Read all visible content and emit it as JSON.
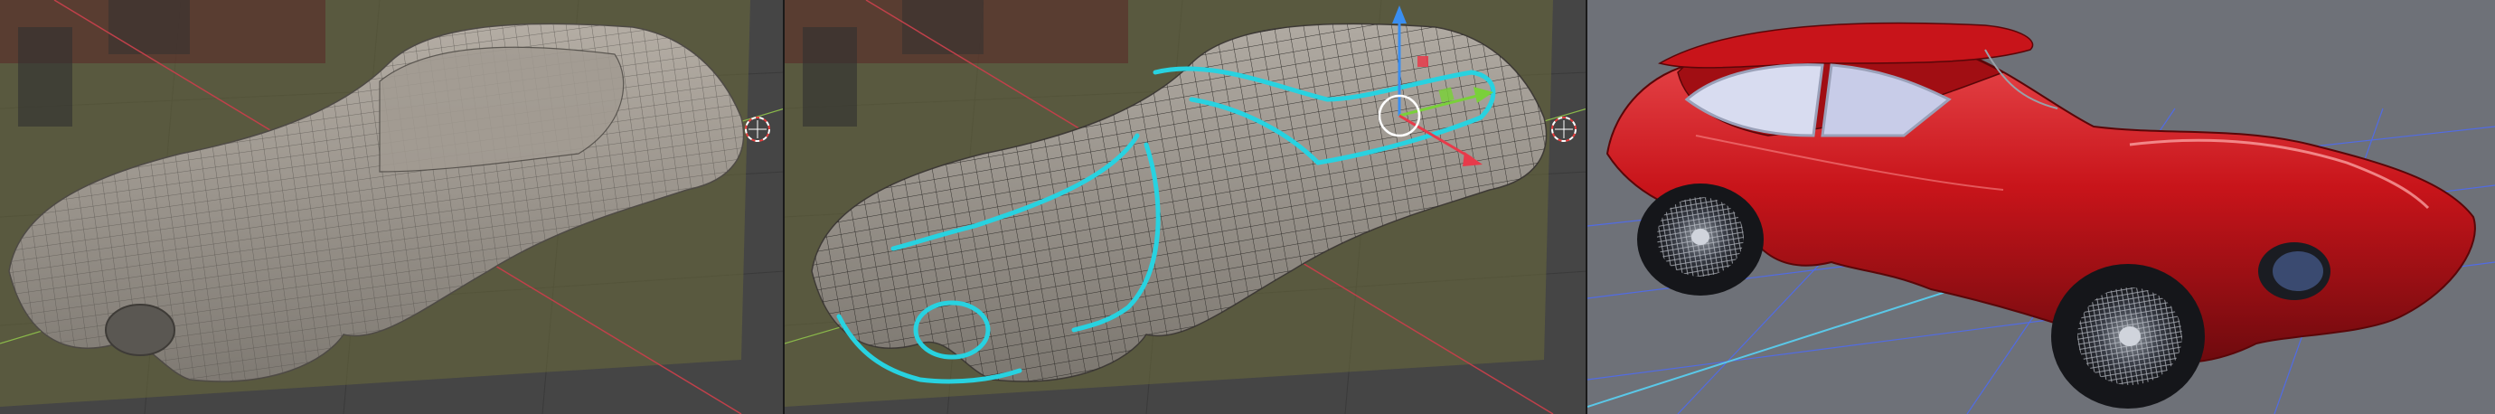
{
  "panels": [
    {
      "name": "wireframe-model",
      "background": "#454545",
      "mesh_color": "#9c968e"
    },
    {
      "name": "wireframe-edge-selection",
      "background": "#454545",
      "selection_color": "#28d2e0"
    },
    {
      "name": "rendered-car",
      "background": "#6e7178",
      "body_color": "#c8141a"
    }
  ],
  "colors": {
    "blueprint_plane": "#6a6a3a",
    "grid_line": "#3a3a3a",
    "axis_red": "#c0404a",
    "axis_green": "#8ab84a",
    "gizmo_blue": "#3a8ef0",
    "gizmo_red": "#e83a4a",
    "gizmo_green": "#7ad03a",
    "floor_grid": "#4a6aff",
    "floor_axis": "#5ac8e8"
  },
  "icons": [
    "3d-cursor-icon",
    "transform-gizmo-icon"
  ]
}
